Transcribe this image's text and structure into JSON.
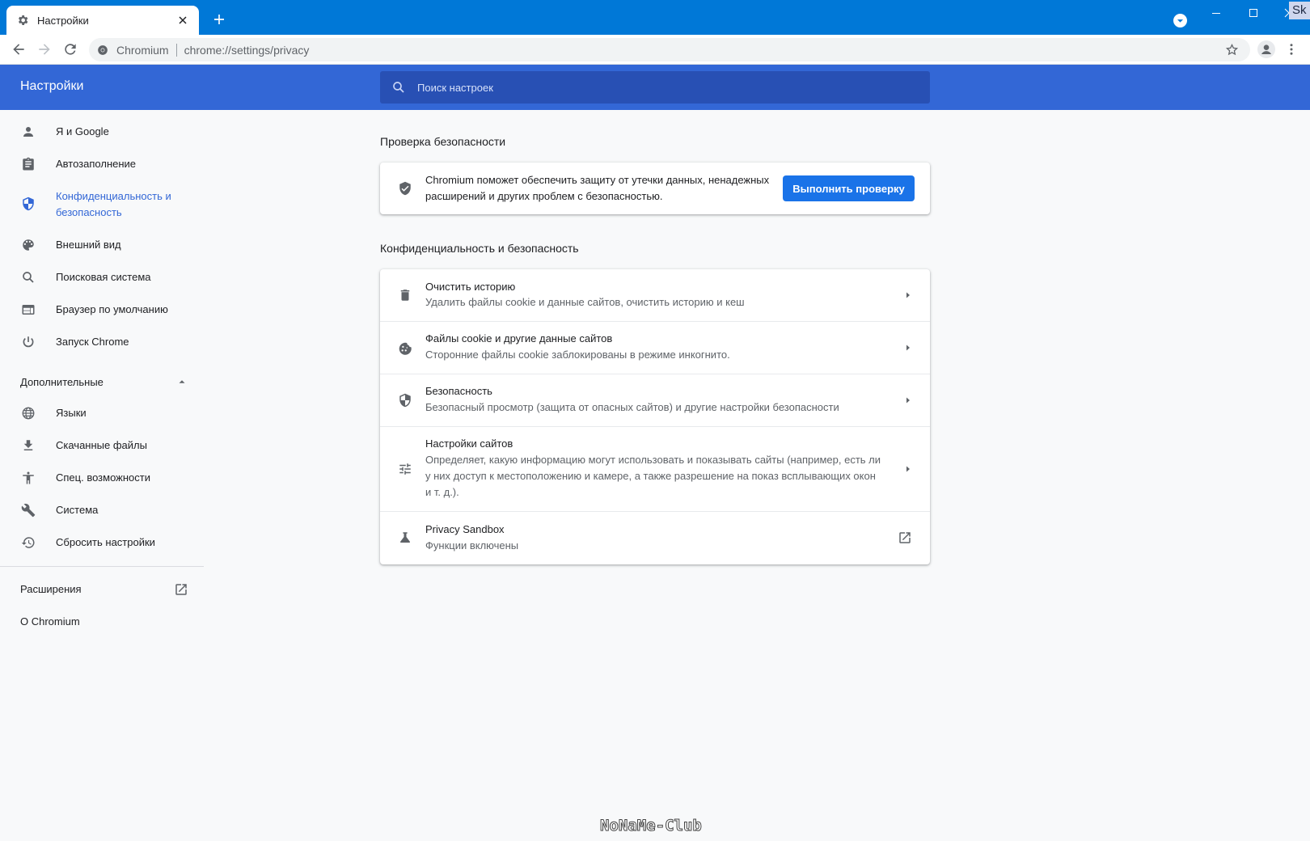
{
  "browser": {
    "tab_title": "Настройки",
    "corner_badge": "Sk",
    "omnibox": {
      "site_name": "Chromium",
      "url_host": "chrome://",
      "url_path": "settings/privacy"
    }
  },
  "settings": {
    "title": "Настройки",
    "search_placeholder": "Поиск настроек"
  },
  "sidebar": {
    "items": [
      {
        "label": "Я и Google",
        "icon": "person-icon"
      },
      {
        "label": "Автозаполнение",
        "icon": "clipboard-icon"
      },
      {
        "label": "Конфиденциальность и безопасность",
        "icon": "shield-icon",
        "active": true
      },
      {
        "label": "Внешний вид",
        "icon": "palette-icon"
      },
      {
        "label": "Поисковая система",
        "icon": "search-icon"
      },
      {
        "label": "Браузер по умолчанию",
        "icon": "browser-window-icon"
      },
      {
        "label": "Запуск Chrome",
        "icon": "power-icon"
      }
    ],
    "advanced_label": "Дополнительные",
    "advanced_items": [
      {
        "label": "Языки",
        "icon": "globe-icon"
      },
      {
        "label": "Скачанные файлы",
        "icon": "download-icon"
      },
      {
        "label": "Спец. возможности",
        "icon": "accessibility-icon"
      },
      {
        "label": "Система",
        "icon": "wrench-icon"
      },
      {
        "label": "Сбросить настройки",
        "icon": "restore-icon"
      }
    ],
    "extensions_label": "Расширения",
    "about_label": "О Chromium"
  },
  "main": {
    "safety_check": {
      "heading": "Проверка безопасности",
      "text": "Chromium поможет обеспечить защиту от утечки данных, ненадежных расширений и других проблем с безопасностью.",
      "button": "Выполнить проверку"
    },
    "privacy": {
      "heading": "Конфиденциальность и безопасность",
      "rows": [
        {
          "title": "Очистить историю",
          "subtitle": "Удалить файлы cookie и данные сайтов, очистить историю и кеш",
          "icon": "trash-icon"
        },
        {
          "title": "Файлы cookie и другие данные сайтов",
          "subtitle": "Сторонние файлы cookie заблокированы в режиме инкогнито.",
          "icon": "cookie-icon"
        },
        {
          "title": "Безопасность",
          "subtitle": "Безопасный просмотр (защита от опасных сайтов) и другие настройки безопасности",
          "icon": "shield-icon"
        },
        {
          "title": "Настройки сайтов",
          "subtitle": "Определяет, какую информацию могут использовать и показывать сайты (например, есть ли у них доступ к местоположению и камере, а также разрешение на показ всплывающих окон и т. д.).",
          "icon": "tune-icon"
        },
        {
          "title": "Privacy Sandbox",
          "subtitle": "Функции включены",
          "icon": "flask-icon"
        }
      ]
    }
  },
  "watermark": "NoNaMe-Club",
  "colors": {
    "titlebar": "#0078d7",
    "header": "#3367d6",
    "search_bg": "#2850b4",
    "accent": "#1a73e8",
    "active_nav": "#3367d6"
  }
}
